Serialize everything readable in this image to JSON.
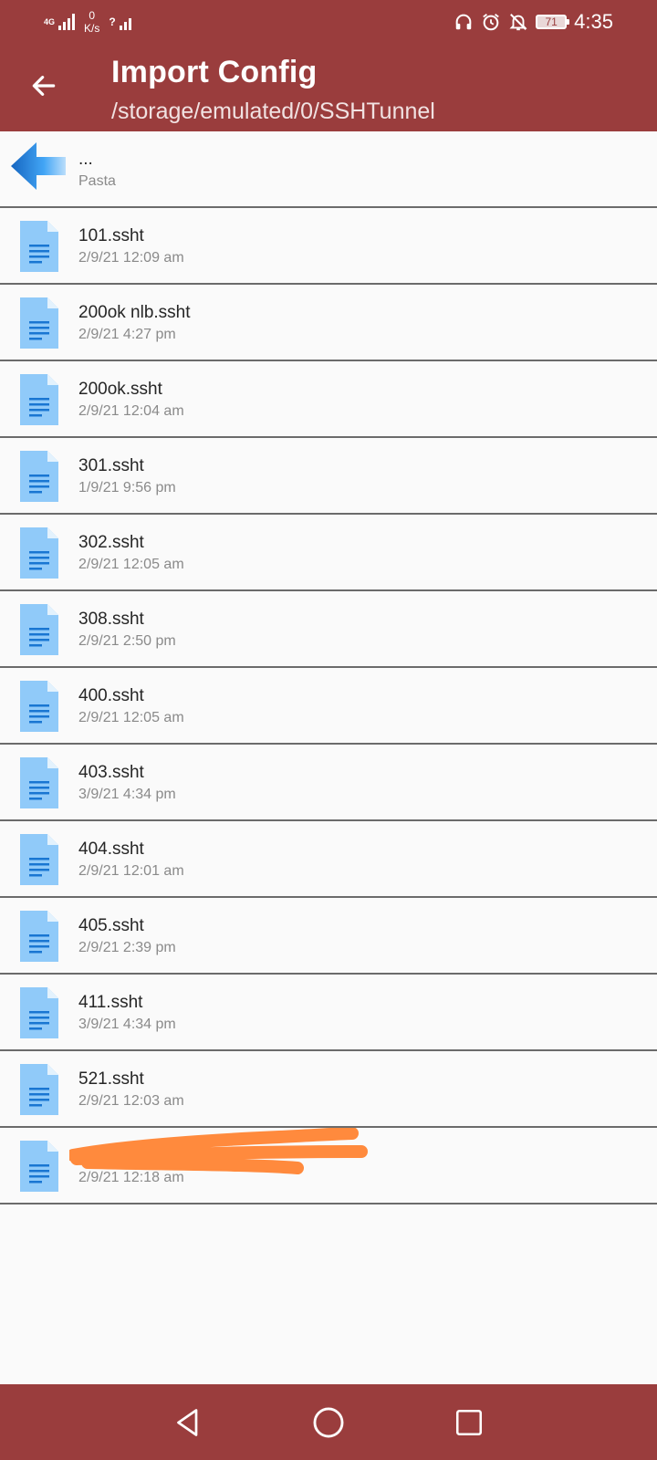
{
  "status_bar": {
    "network_label": "4G",
    "speed_value": "0",
    "speed_unit": "K/s",
    "sim2_label": "?",
    "battery_level": "71",
    "time": "4:35",
    "icons": [
      "headphones-icon",
      "alarm-icon",
      "bell-off-icon"
    ]
  },
  "app_bar": {
    "title": "Import Config",
    "subtitle": "/storage/emulated/0/SSHTunnel"
  },
  "parent_item": {
    "name": "...",
    "detail": "Pasta"
  },
  "files": [
    {
      "name": "101.ssht",
      "date": "2/9/21 12:09 am"
    },
    {
      "name": "200ok nlb.ssht",
      "date": "2/9/21 4:27 pm"
    },
    {
      "name": "200ok.ssht",
      "date": "2/9/21 12:04 am"
    },
    {
      "name": "301.ssht",
      "date": "1/9/21 9:56 pm"
    },
    {
      "name": "302.ssht",
      "date": "2/9/21 12:05 am"
    },
    {
      "name": "308.ssht",
      "date": "2/9/21 2:50 pm"
    },
    {
      "name": "400.ssht",
      "date": "2/9/21 12:05 am"
    },
    {
      "name": "403.ssht",
      "date": "3/9/21 4:34 pm"
    },
    {
      "name": "404.ssht",
      "date": "2/9/21 12:01 am"
    },
    {
      "name": "405.ssht",
      "date": "2/9/21 2:39 pm"
    },
    {
      "name": "411.ssht",
      "date": "3/9/21 4:34 pm"
    },
    {
      "name": "521.ssht",
      "date": "2/9/21 12:03 am"
    },
    {
      "name": "",
      "date": "2/9/21 12:18 am"
    }
  ],
  "colors": {
    "primary": "#9a3d3d",
    "file_icon": "#90caf9",
    "file_icon_lines": "#1976d2",
    "scribble": "#ff8a3d"
  }
}
